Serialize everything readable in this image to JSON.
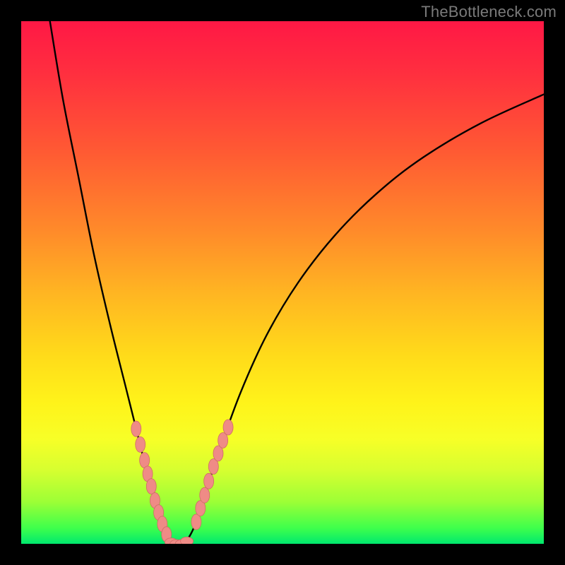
{
  "watermark": "TheBottleneck.com",
  "colors": {
    "curve_stroke": "#000000",
    "marker_fill": "#ef8b86",
    "marker_stroke": "#cf6c66"
  },
  "chart_data": {
    "type": "line",
    "title": "",
    "xlabel": "",
    "ylabel": "",
    "xlim": [
      0,
      100
    ],
    "ylim": [
      0,
      100
    ],
    "curve": [
      {
        "x": 5.5,
        "y": 100
      },
      {
        "x": 8,
        "y": 85
      },
      {
        "x": 11,
        "y": 70
      },
      {
        "x": 14,
        "y": 55
      },
      {
        "x": 17,
        "y": 42
      },
      {
        "x": 20,
        "y": 30
      },
      {
        "x": 22,
        "y": 22
      },
      {
        "x": 24,
        "y": 14
      },
      {
        "x": 26,
        "y": 7
      },
      {
        "x": 27.5,
        "y": 2
      },
      {
        "x": 29,
        "y": 0
      },
      {
        "x": 31,
        "y": 0
      },
      {
        "x": 33,
        "y": 3
      },
      {
        "x": 35,
        "y": 9
      },
      {
        "x": 38,
        "y": 18
      },
      {
        "x": 42,
        "y": 29
      },
      {
        "x": 47,
        "y": 40
      },
      {
        "x": 53,
        "y": 50
      },
      {
        "x": 60,
        "y": 59
      },
      {
        "x": 68,
        "y": 67
      },
      {
        "x": 77,
        "y": 74
      },
      {
        "x": 88,
        "y": 80.5
      },
      {
        "x": 100,
        "y": 86
      }
    ],
    "markers_left": [
      {
        "x": 22.0,
        "y": 22.0
      },
      {
        "x": 22.8,
        "y": 19.0
      },
      {
        "x": 23.6,
        "y": 16.0
      },
      {
        "x": 24.2,
        "y": 13.4
      },
      {
        "x": 24.9,
        "y": 11.0
      },
      {
        "x": 25.6,
        "y": 8.3
      },
      {
        "x": 26.3,
        "y": 6.0
      },
      {
        "x": 27.0,
        "y": 3.8
      },
      {
        "x": 27.8,
        "y": 1.8
      }
    ],
    "markers_right": [
      {
        "x": 33.5,
        "y": 4.2
      },
      {
        "x": 34.3,
        "y": 6.8
      },
      {
        "x": 35.1,
        "y": 9.3
      },
      {
        "x": 35.9,
        "y": 12.0
      },
      {
        "x": 36.8,
        "y": 14.8
      },
      {
        "x": 37.7,
        "y": 17.3
      },
      {
        "x": 38.6,
        "y": 19.8
      },
      {
        "x": 39.6,
        "y": 22.3
      }
    ],
    "markers_bottom": [
      {
        "x": 28.7,
        "y": 0.3
      },
      {
        "x": 29.7,
        "y": 0.0
      },
      {
        "x": 30.7,
        "y": 0.0
      },
      {
        "x": 31.7,
        "y": 0.5
      }
    ]
  }
}
